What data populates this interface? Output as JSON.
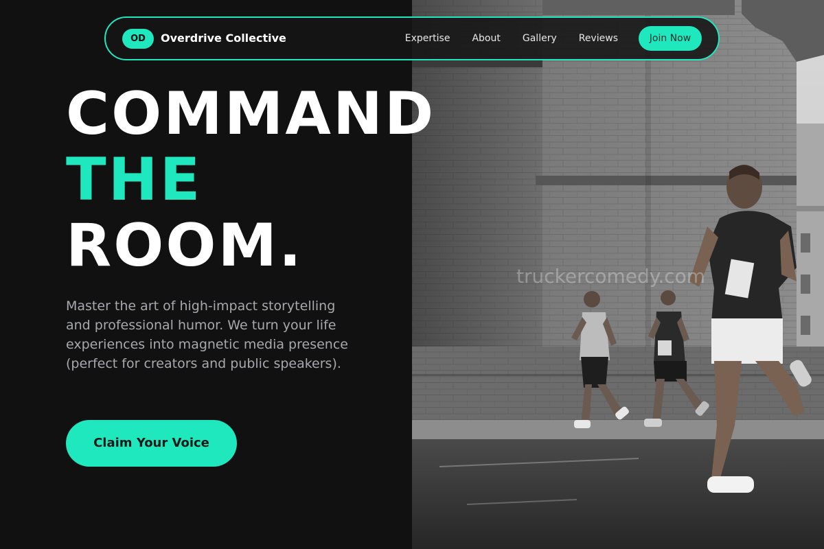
{
  "navbar": {
    "logo_text": "OD",
    "brand_name": "Overdrive Collective",
    "links": [
      "Expertise",
      "About",
      "Gallery",
      "Reviews"
    ],
    "join_label": "Join Now"
  },
  "hero": {
    "headline": {
      "line1": "COMMAND",
      "line2": "THE",
      "line3": "ROOM."
    },
    "description": "Master the art of high-impact storytelling and professional humor. We turn your life experiences into magnetic media presence (perfect for creators and public speakers).",
    "cta_label": "Claim Your Voice",
    "image_watermark": "truckercomedy.com"
  },
  "colors": {
    "accent": "#1fe8be",
    "background": "#111112",
    "text_muted": "#a8a9ad"
  },
  "icons": {
    "hero_photo": "marathon-runners-photo"
  }
}
